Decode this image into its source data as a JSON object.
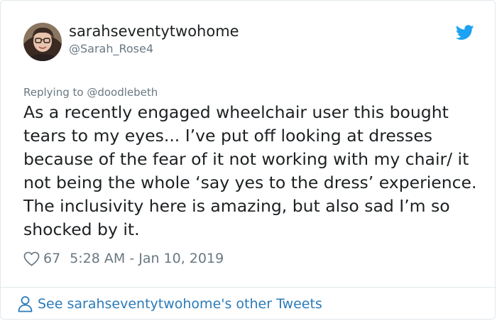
{
  "tweet": {
    "display_name": "sarahseventytwohome",
    "handle": "@Sarah_Rose4",
    "replying_prefix": "Replying to",
    "replying_to": "@doodlebeth",
    "text": "As a recently engaged wheelchair user this bought tears to my eyes... I’ve put off looking at dresses because of the fear of it not working with my chair/ it not being the whole ‘say yes to the dress’ experience. The inclusivity here is amazing, but also sad I’m so shocked by it.",
    "like_count": "67",
    "timestamp": "5:28 AM - Jan 10, 2019"
  },
  "footer": {
    "see_more": "See sarahseventytwohome's other Tweets"
  },
  "icons": {
    "logo": "twitter-bird-icon",
    "like": "heart-icon",
    "profile": "person-icon"
  },
  "colors": {
    "twitter_blue": "#1da1f2",
    "link_blue": "#2b7bb9",
    "text_primary": "#1c2022",
    "text_secondary": "#697882",
    "border": "#e1e8ed"
  }
}
